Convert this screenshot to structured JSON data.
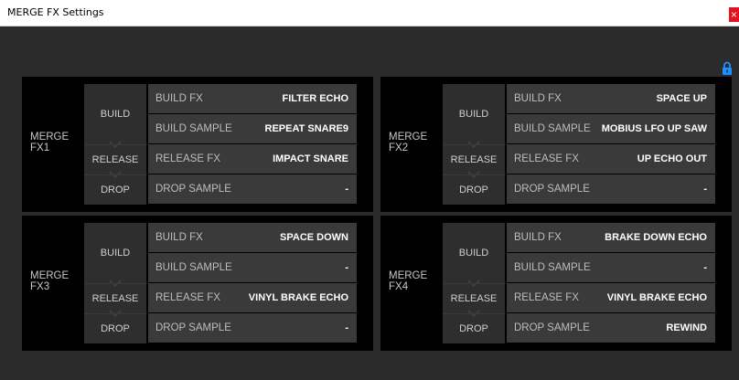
{
  "window": {
    "title": "MERGE FX Settings",
    "close_icon": "×"
  },
  "labels": {
    "build": "BUILD",
    "release": "RELEASE",
    "drop": "DROP"
  },
  "panels": [
    {
      "line1": "MERGE",
      "line2": "FX1",
      "rows": [
        {
          "label": "BUILD FX",
          "value": "FILTER ECHO"
        },
        {
          "label": "BUILD SAMPLE",
          "value": "REPEAT SNARE9"
        },
        {
          "label": "RELEASE FX",
          "value": "IMPACT SNARE"
        },
        {
          "label": "DROP SAMPLE",
          "value": "-"
        }
      ]
    },
    {
      "line1": "MERGE",
      "line2": "FX2",
      "rows": [
        {
          "label": "BUILD FX",
          "value": "SPACE UP"
        },
        {
          "label": "BUILD SAMPLE",
          "value": "MOBIUS LFO UP SAW"
        },
        {
          "label": "RELEASE FX",
          "value": "UP ECHO OUT"
        },
        {
          "label": "DROP SAMPLE",
          "value": "-"
        }
      ]
    },
    {
      "line1": "MERGE",
      "line2": "FX3",
      "rows": [
        {
          "label": "BUILD FX",
          "value": "SPACE DOWN"
        },
        {
          "label": "BUILD SAMPLE",
          "value": "-"
        },
        {
          "label": "RELEASE FX",
          "value": "VINYL BRAKE ECHO"
        },
        {
          "label": "DROP SAMPLE",
          "value": "-"
        }
      ]
    },
    {
      "line1": "MERGE",
      "line2": "FX4",
      "rows": [
        {
          "label": "BUILD FX",
          "value": "BRAKE DOWN ECHO"
        },
        {
          "label": "BUILD SAMPLE",
          "value": "-"
        },
        {
          "label": "RELEASE FX",
          "value": "VINYL BRAKE ECHO"
        },
        {
          "label": "DROP SAMPLE",
          "value": "REWIND"
        }
      ]
    }
  ],
  "colors": {
    "accent_lock": "#1e90ff",
    "close": "#e81123",
    "panel_bg": "#000000",
    "row_bg": "#3a3a3a",
    "window_bg": "#2b2b2b"
  }
}
